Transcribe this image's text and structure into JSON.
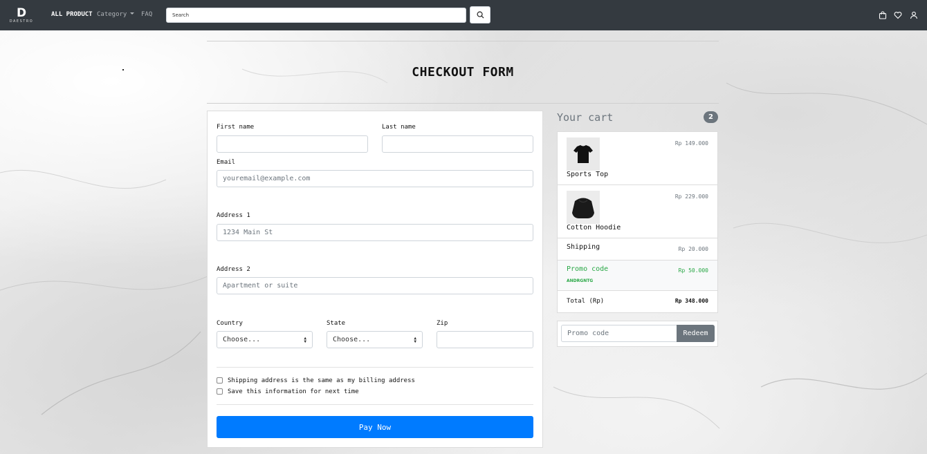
{
  "brand": {
    "mark": "D",
    "word": "DAESTRO"
  },
  "nav": {
    "all_product": "ALL PRODUCT",
    "category": "Category",
    "faq": "FAQ",
    "search_placeholder": "Search"
  },
  "page": {
    "title": "CHECKOUT FORM"
  },
  "form": {
    "first_name_label": "First name",
    "last_name_label": "Last name",
    "email_label": "Email",
    "email_placeholder": "youremail@example.com",
    "address1_label": "Address 1",
    "address1_placeholder": "1234 Main St",
    "address2_label": "Address 2",
    "address2_placeholder": "Apartment or suite",
    "country_label": "Country",
    "country_value": "Choose...",
    "state_label": "State",
    "state_value": "Choose...",
    "zip_label": "Zip",
    "same_address_label": "Shipping address is the same as my billing address",
    "save_info_label": "Save this information for next time",
    "pay_button": "Pay Now"
  },
  "cart": {
    "title": "Your cart",
    "count": "2",
    "items": [
      {
        "name": "Sports Top",
        "price": "Rp 149.000"
      },
      {
        "name": "Cotton Hoodie",
        "price": "Rp 229.000"
      }
    ],
    "shipping_label": "Shipping",
    "shipping_price": "Rp 20.000",
    "promo_label": "Promo code",
    "promo_code": "ANDRGNTG",
    "promo_price": "Rp 50.000",
    "total_label": "Total (Rp)",
    "total_price": "Rp 348.000",
    "promo_input_placeholder": "Promo code",
    "redeem_button": "Redeem"
  },
  "colors": {
    "navbar": "#343a40",
    "primary": "#007bff",
    "secondary": "#6c757d",
    "success": "#28a745"
  }
}
